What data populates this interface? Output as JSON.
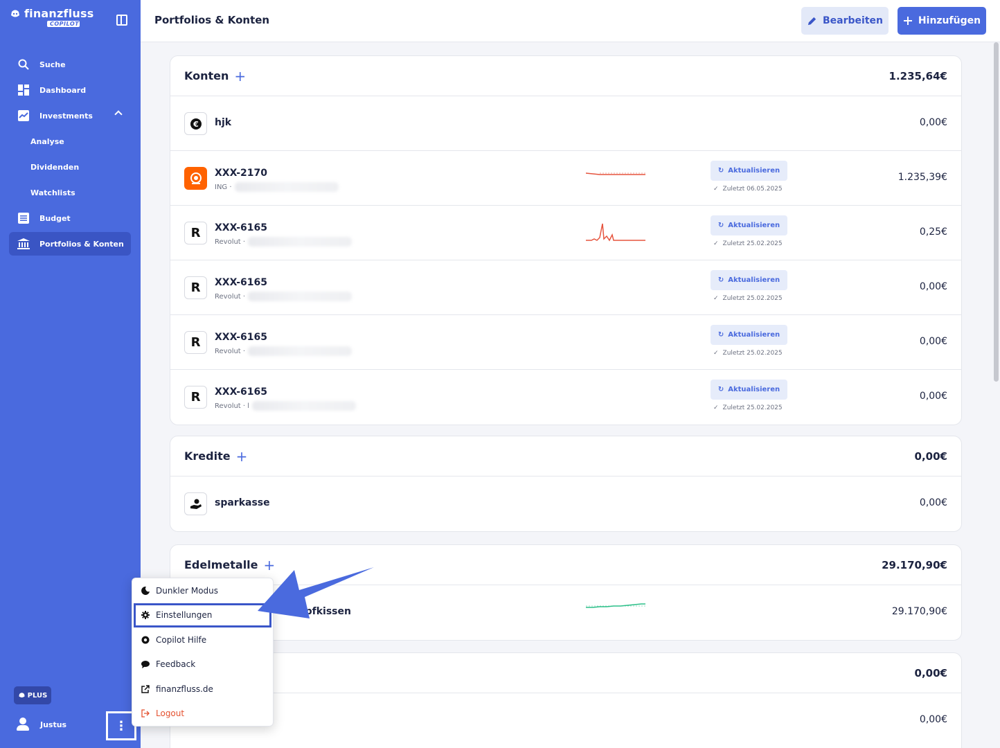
{
  "brand": {
    "name": "finanzfluss",
    "badge": "COPILOT"
  },
  "sidebar": {
    "items": [
      {
        "label": "Suche",
        "icon": "search-icon"
      },
      {
        "label": "Dashboard",
        "icon": "dashboard-icon"
      },
      {
        "label": "Investments",
        "icon": "chart-icon"
      },
      {
        "label": "Analyse"
      },
      {
        "label": "Dividenden"
      },
      {
        "label": "Watchlists"
      },
      {
        "label": "Budget",
        "icon": "list-icon"
      },
      {
        "label": "Portfolios & Konten",
        "icon": "bank-icon"
      }
    ],
    "plus_label": "PLUS",
    "user_name": "Justus",
    "more_glyph": "⋮"
  },
  "header": {
    "title": "Portfolios & Konten",
    "edit_label": "Bearbeiten",
    "add_label": "Hinzufügen"
  },
  "konten": {
    "title": "Konten",
    "total": "1.235,64€",
    "rows": [
      {
        "name": "hjk",
        "amount": "0,00€",
        "logo": "€"
      },
      {
        "name": "XXX-2170",
        "bank": "ING ·",
        "amount": "1.235,39€",
        "refresh": "Aktualisieren",
        "last": "Zuletzt 06.05.2025",
        "logo": "🦁"
      },
      {
        "name": "XXX-6165",
        "bank": "Revolut ·",
        "amount": "0,25€",
        "refresh": "Aktualisieren",
        "last": "Zuletzt 25.02.2025",
        "logo": "R"
      },
      {
        "name": "XXX-6165",
        "bank": "Revolut ·",
        "amount": "0,00€",
        "refresh": "Aktualisieren",
        "last": "Zuletzt 25.02.2025",
        "logo": "R"
      },
      {
        "name": "XXX-6165",
        "bank": "Revolut ·",
        "amount": "0,00€",
        "refresh": "Aktualisieren",
        "last": "Zuletzt 25.02.2025",
        "logo": "R"
      },
      {
        "name": "XXX-6165",
        "bank": "Revolut · l",
        "amount": "0,00€",
        "refresh": "Aktualisieren",
        "last": "Zuletzt 25.02.2025",
        "logo": "R"
      }
    ]
  },
  "kredite": {
    "title": "Kredite",
    "total": "0,00€",
    "rows": [
      {
        "name": "sparkasse",
        "amount": "0,00€"
      }
    ]
  },
  "edelmetalle": {
    "title": "Edelmetalle",
    "total": "29.170,90€",
    "rows": [
      {
        "name": "opfkissen",
        "amount": "29.170,90€"
      }
    ]
  },
  "other": {
    "total": "0,00€",
    "rows": [
      {
        "amount": "0,00€"
      }
    ]
  },
  "menu": {
    "items": [
      {
        "label": "Dunkler Modus",
        "icon": "moon-icon"
      },
      {
        "label": "Einstellungen",
        "icon": "gear-icon"
      },
      {
        "label": "Copilot Hilfe",
        "icon": "help-icon"
      },
      {
        "label": "Feedback",
        "icon": "chat-icon"
      },
      {
        "label": "finanzfluss.de",
        "icon": "external-link-icon"
      },
      {
        "label": "Logout",
        "icon": "logout-icon"
      }
    ]
  },
  "colors": {
    "accent": "#4a6ade",
    "logout": "#e4502e",
    "spark_red": "#e5533d",
    "spark_green": "#2bbf88"
  }
}
